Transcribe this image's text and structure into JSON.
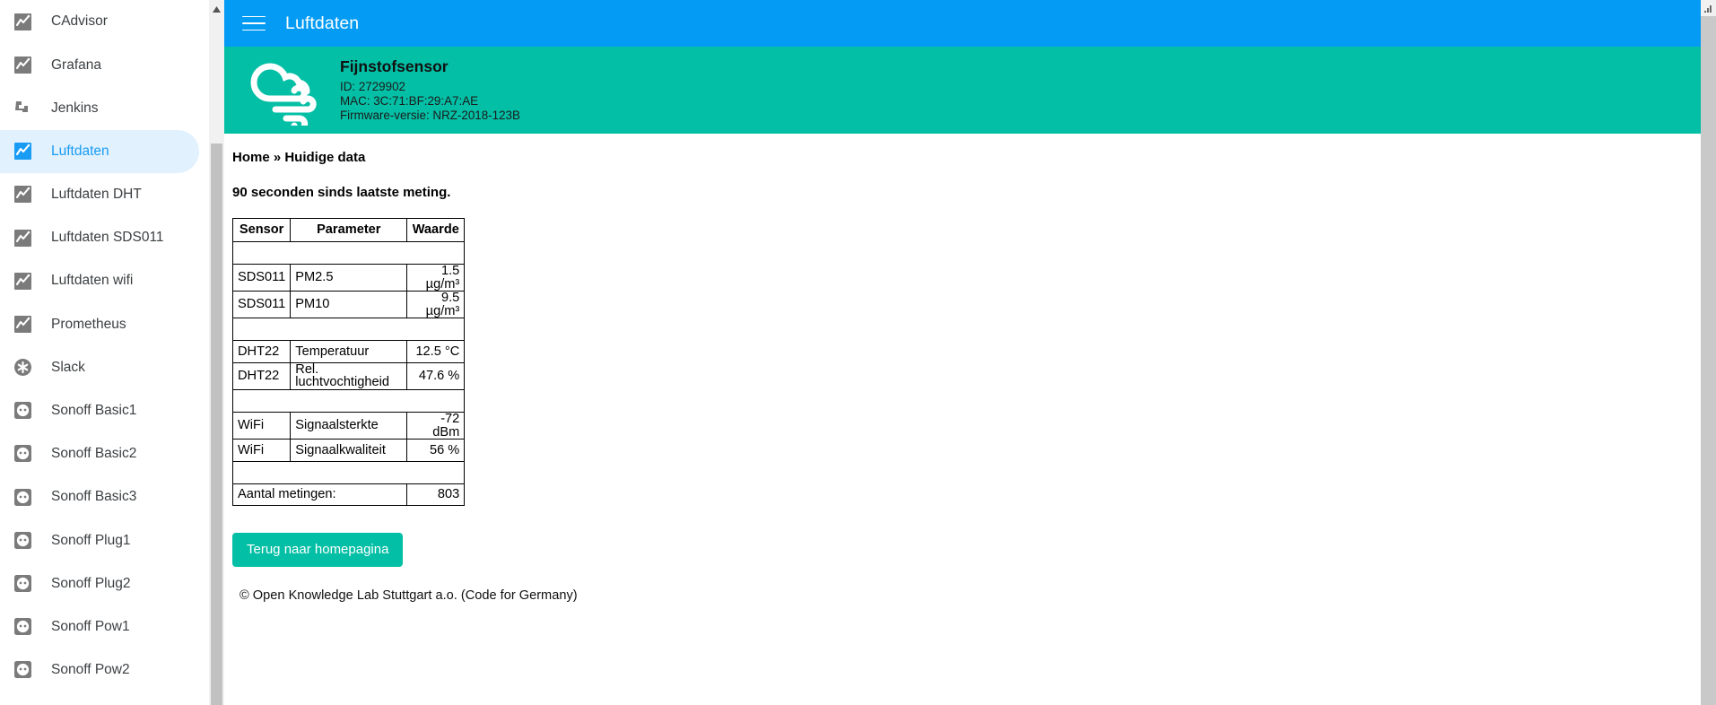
{
  "sidebar": {
    "items": [
      {
        "label": "CAdvisor",
        "icon": "chart-icon",
        "active": false
      },
      {
        "label": "Grafana",
        "icon": "chart-icon",
        "active": false
      },
      {
        "label": "Jenkins",
        "icon": "jenkins-icon",
        "active": false
      },
      {
        "label": "Luftdaten",
        "icon": "chart-icon",
        "active": true
      },
      {
        "label": "Luftdaten DHT",
        "icon": "chart-icon",
        "active": false
      },
      {
        "label": "Luftdaten SDS011",
        "icon": "chart-icon",
        "active": false
      },
      {
        "label": "Luftdaten wifi",
        "icon": "chart-icon",
        "active": false
      },
      {
        "label": "Prometheus",
        "icon": "chart-icon",
        "active": false
      },
      {
        "label": "Slack",
        "icon": "slack-icon",
        "active": false
      },
      {
        "label": "Sonoff Basic1",
        "icon": "socket-icon",
        "active": false
      },
      {
        "label": "Sonoff Basic2",
        "icon": "socket-icon",
        "active": false
      },
      {
        "label": "Sonoff Basic3",
        "icon": "socket-icon",
        "active": false
      },
      {
        "label": "Sonoff Plug1",
        "icon": "socket-icon",
        "active": false
      },
      {
        "label": "Sonoff Plug2",
        "icon": "socket-icon",
        "active": false
      },
      {
        "label": "Sonoff Pow1",
        "icon": "socket-icon",
        "active": false
      },
      {
        "label": "Sonoff Pow2",
        "icon": "socket-icon",
        "active": false
      }
    ]
  },
  "appbar": {
    "menu_icon": "hamburger-icon",
    "title": "Luftdaten"
  },
  "banner": {
    "icon": "cloud-wind-icon",
    "sensor_name": "Fijnstofsensor",
    "id_line": "ID: 2729902",
    "mac_line": "MAC: 3C:71:BF:29:A7:AE",
    "firmware_line": "Firmware-versie: NRZ-2018-123B"
  },
  "main": {
    "breadcrumb": "Home » Huidige data",
    "last_measurement": "90 seconden sinds laatste meting.",
    "table": {
      "headers": [
        "Sensor",
        "Parameter",
        "Waarde"
      ],
      "rows": [
        {
          "type": "spacer",
          "sensor": "",
          "parameter": "",
          "value": ""
        },
        {
          "type": "data",
          "sensor": "SDS011",
          "parameter": "PM2.5",
          "value": "1.5 µg/m³"
        },
        {
          "type": "data",
          "sensor": "SDS011",
          "parameter": "PM10",
          "value": "9.5 µg/m³"
        },
        {
          "type": "spacer",
          "sensor": "",
          "parameter": "",
          "value": ""
        },
        {
          "type": "data",
          "sensor": "DHT22",
          "parameter": "Temperatuur",
          "value": "12.5 °C"
        },
        {
          "type": "data",
          "sensor": "DHT22",
          "parameter": "Rel. luchtvochtigheid",
          "value": "47.6 %"
        },
        {
          "type": "spacer",
          "sensor": "",
          "parameter": "",
          "value": ""
        },
        {
          "type": "data",
          "sensor": "WiFi",
          "parameter": "Signaalsterkte",
          "value": "-72 dBm"
        },
        {
          "type": "data",
          "sensor": "WiFi",
          "parameter": "Signaalkwaliteit",
          "value": "56 %"
        },
        {
          "type": "spacer",
          "sensor": "",
          "parameter": "",
          "value": ""
        }
      ],
      "total_label": "Aantal metingen:",
      "total_value": "803"
    },
    "home_button": "Terug naar homepagina",
    "footer": "© Open Knowledge Lab Stuttgart a.o. (Code for Germany)"
  },
  "colors": {
    "appbar_blue": "#039bf4",
    "banner_teal": "#03bfa5",
    "active_item_bg": "#e1f1fe",
    "active_item_fg": "#1a9cf5",
    "button_teal": "#03bfa5"
  }
}
